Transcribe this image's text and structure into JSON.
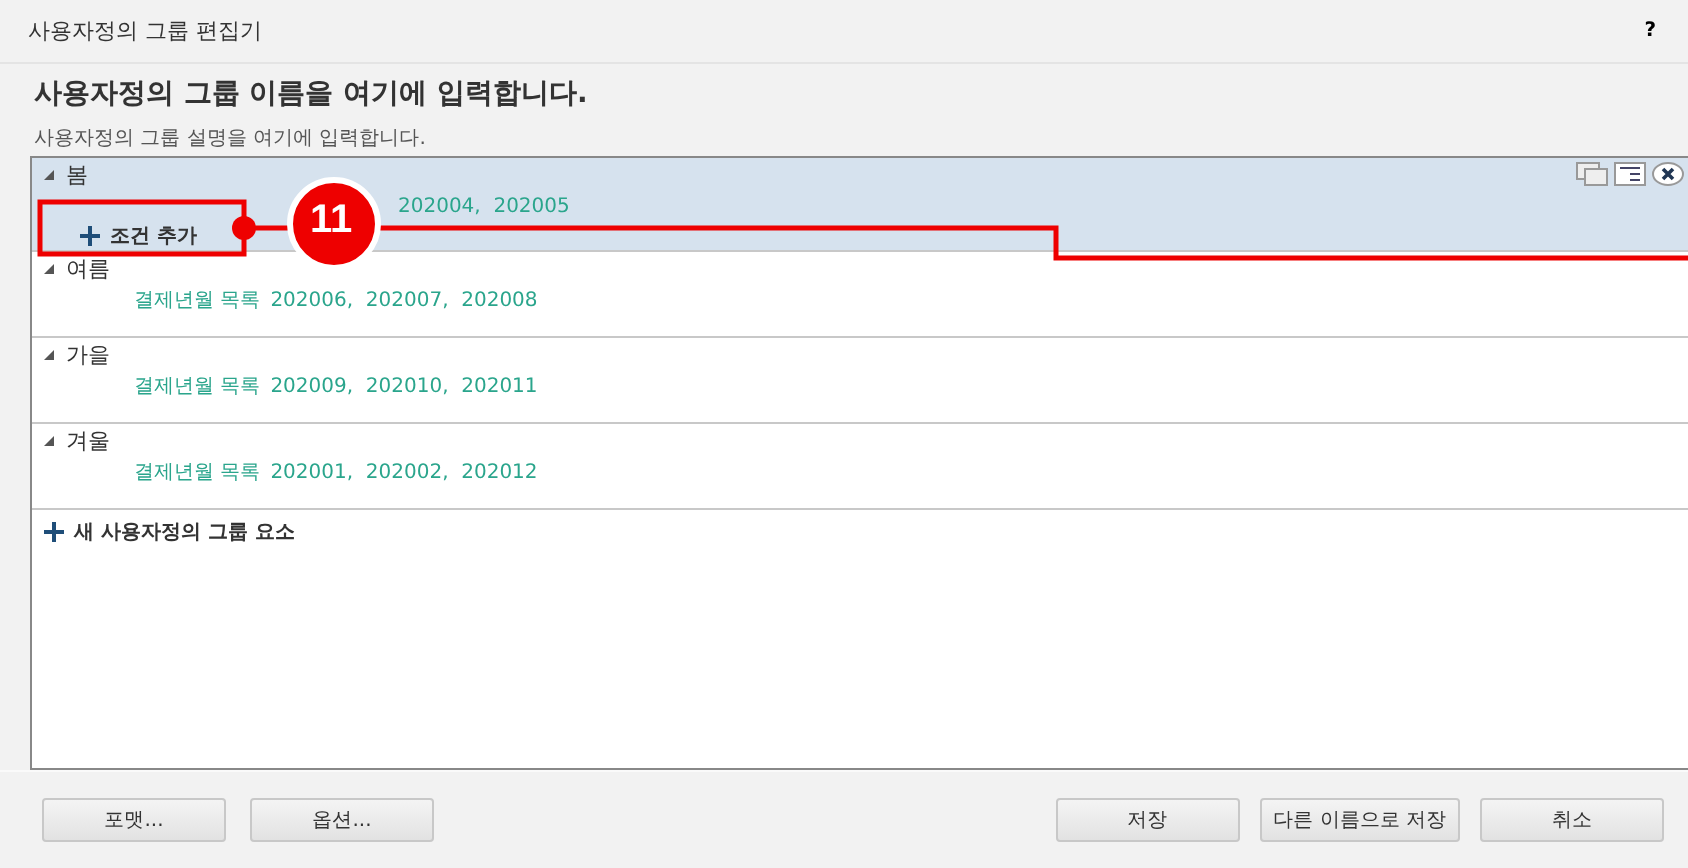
{
  "window": {
    "title": "사용자정의 그룹 편집기",
    "help": "?"
  },
  "group_name": "사용자정의 그룹 이름을 여기에 입력합니다.",
  "group_description": "사용자정의 그룹 설명을 여기에 입력합니다.",
  "groups": [
    {
      "name": "봄",
      "selected": true,
      "expanded": true,
      "values": "202004,  202005",
      "partly_hidden": true,
      "add_condition": "조건 추가"
    },
    {
      "name": "여름",
      "selected": false,
      "expanded": true,
      "prefix": "결제년월 목록",
      "values": "202006,  202007,  202008",
      "partly_hidden": false
    },
    {
      "name": "가을",
      "selected": false,
      "expanded": true,
      "prefix": "결제년월 목록",
      "values": "202009,  202010,  202011",
      "partly_hidden": false
    },
    {
      "name": "겨울",
      "selected": false,
      "expanded": true,
      "prefix": "결제년월 목록",
      "values": "202001,  202002,  202012",
      "partly_hidden": false
    }
  ],
  "new_element": "새 사용자정의 그룹 요소",
  "callout": {
    "number": "11"
  },
  "buttons_left": [
    "포맷...",
    "옵션..."
  ],
  "buttons_right": [
    "저장",
    "다른 이름으로 저장",
    "취소"
  ]
}
